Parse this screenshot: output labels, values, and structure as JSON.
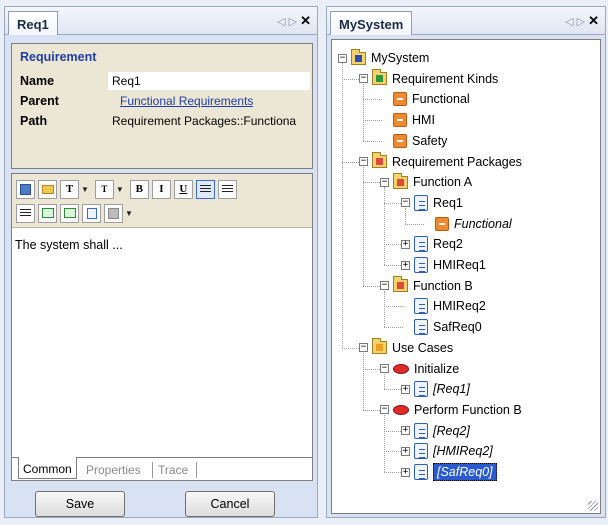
{
  "left_panel": {
    "tab_title": "Req1",
    "properties": {
      "section_title": "Requirement",
      "name_label": "Name",
      "name_value": "Req1",
      "parent_label": "Parent",
      "parent_value": "Functional Requirements",
      "path_label": "Path",
      "path_value": "Requirement Packages::Functiona"
    },
    "toolbar": {
      "row1": [
        "save-icon",
        "open-folder-icon",
        "T",
        "T",
        "B",
        "I",
        "U",
        "align-left-icon",
        "align-center-icon"
      ],
      "row2": [
        "align-right-icon",
        "undo-icon",
        "redo-icon",
        "table-icon",
        "color-icon"
      ]
    },
    "editor_text": "The system shall ...",
    "tabs": [
      "Common",
      "Properties",
      "Trace"
    ],
    "active_tab": "Common",
    "save_label": "Save",
    "cancel_label": "Cancel"
  },
  "right_panel": {
    "tab_title": "MySystem",
    "tree": [
      {
        "label": "MySystem",
        "icon": "package-blue-icon",
        "expander": "-",
        "depth": 0
      },
      {
        "label": "Requirement Kinds",
        "icon": "package-green-icon",
        "expander": "-",
        "depth": 1
      },
      {
        "label": "Functional",
        "icon": "requirement-kind-icon",
        "expander": "",
        "depth": 2
      },
      {
        "label": "HMI",
        "icon": "requirement-kind-icon",
        "expander": "",
        "depth": 2
      },
      {
        "label": "Safety",
        "icon": "requirement-kind-icon",
        "expander": "",
        "depth": 2
      },
      {
        "label": "Requirement Packages",
        "icon": "package-red-icon",
        "expander": "-",
        "depth": 1
      },
      {
        "label": "Function A",
        "icon": "package-red-icon",
        "expander": "-",
        "depth": 2
      },
      {
        "label": "Req1",
        "icon": "requirement-icon",
        "expander": "-",
        "depth": 3
      },
      {
        "label": "Functional",
        "icon": "requirement-kind-icon",
        "expander": "",
        "depth": 4,
        "italic": true
      },
      {
        "label": "Req2",
        "icon": "requirement-icon",
        "expander": "+",
        "depth": 3
      },
      {
        "label": "HMIReq1",
        "icon": "requirement-icon",
        "expander": "+",
        "depth": 3
      },
      {
        "label": "Function B",
        "icon": "package-red-icon",
        "expander": "-",
        "depth": 2
      },
      {
        "label": "HMIReq2",
        "icon": "requirement-icon",
        "expander": "",
        "depth": 3
      },
      {
        "label": "SafReq0",
        "icon": "requirement-icon",
        "expander": "",
        "depth": 3
      },
      {
        "label": "Use Cases",
        "icon": "package-orange-icon",
        "expander": "-",
        "depth": 1
      },
      {
        "label": "Initialize",
        "icon": "use-case-icon",
        "expander": "-",
        "depth": 2
      },
      {
        "label": "[Req1]",
        "icon": "requirement-icon",
        "expander": "+",
        "depth": 3,
        "italic": true
      },
      {
        "label": "Perform Function B",
        "icon": "use-case-icon",
        "expander": "-",
        "depth": 2
      },
      {
        "label": "[Req2]",
        "icon": "requirement-icon",
        "expander": "+",
        "depth": 3,
        "italic": true
      },
      {
        "label": "[HMIReq2]",
        "icon": "requirement-icon",
        "expander": "+",
        "depth": 3,
        "italic": true
      },
      {
        "label": "[SafReq0]",
        "icon": "requirement-icon",
        "expander": "+",
        "depth": 3,
        "italic": true,
        "selected": true
      }
    ]
  },
  "colors": {
    "link": "#1e3ea8",
    "selection": "#2a5ad0",
    "property_bg": "#ece6d4"
  }
}
